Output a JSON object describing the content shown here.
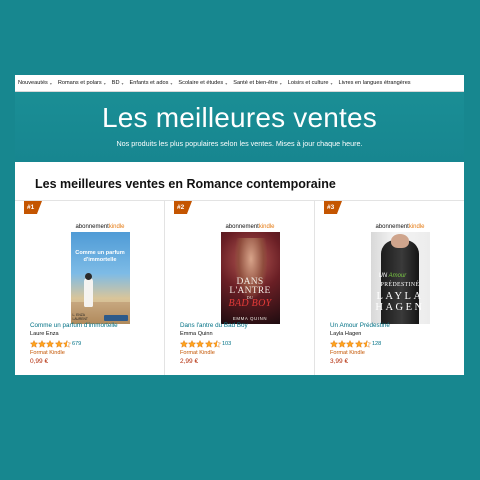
{
  "colors": {
    "background": "#17878f",
    "hero": "#1a8e95",
    "rank_badge": "#c45500",
    "link": "#007185",
    "price": "#b12704",
    "star": "#ffa41c",
    "kindle_accent": "#e47911"
  },
  "nav": {
    "items": [
      {
        "label": "Nouveautés",
        "has_dropdown": true
      },
      {
        "label": "Romans et polars",
        "has_dropdown": true
      },
      {
        "label": "BD",
        "has_dropdown": true
      },
      {
        "label": "Enfants et ados",
        "has_dropdown": true
      },
      {
        "label": "Scolaire et études",
        "has_dropdown": true
      },
      {
        "label": "Santé et bien-être",
        "has_dropdown": true
      },
      {
        "label": "Loisirs et culture",
        "has_dropdown": true
      },
      {
        "label": "Livres en langues étrangères",
        "has_dropdown": false
      }
    ],
    "dropdown_icon": "chevron-down-icon"
  },
  "hero": {
    "title": "Les meilleures ventes",
    "subtitle": "Nos produits les plus populaires selon les ventes. Mises à jour chaque heure."
  },
  "section": {
    "title": "Les meilleures ventes en Romance contemporaine"
  },
  "products": [
    {
      "rank": "#1",
      "badge_part1": "abonnement",
      "badge_part2": "kindle",
      "cover": {
        "line1": "Comme un parfum",
        "line2": "d'immortelle",
        "author": "L. ENZA",
        "author2": "LAURENT"
      },
      "title": "Comme un parfum d'immortelle",
      "author": "Laure Enza",
      "rating": 4.5,
      "review_count": "679",
      "format": "Format Kindle",
      "price": "0,99 €"
    },
    {
      "rank": "#2",
      "badge_part1": "abonnement",
      "badge_part2": "kindle",
      "cover": {
        "line1": "DANS",
        "line2": "L'ANTRE",
        "line3": "DU",
        "line4": "BAD BOY",
        "author": "EMMA QUINN"
      },
      "title": "Dans l'antre du Bad Boy",
      "author": "Emma Quinn",
      "rating": 4.5,
      "review_count": "103",
      "format": "Format Kindle",
      "price": "2,99 €"
    },
    {
      "rank": "#3",
      "badge_part1": "abonnement",
      "badge_part2": "kindle",
      "cover": {
        "line1": "UN",
        "line1b": "Amour",
        "line2": "PRÉDESTINÉ",
        "author1": "LAYLA",
        "author2": "HAGEN"
      },
      "title": "Un Amour Prédestiné",
      "author": "Layla Hagen",
      "rating": 4.5,
      "review_count": "128",
      "format": "Format Kindle",
      "price": "3,99 €"
    }
  ]
}
